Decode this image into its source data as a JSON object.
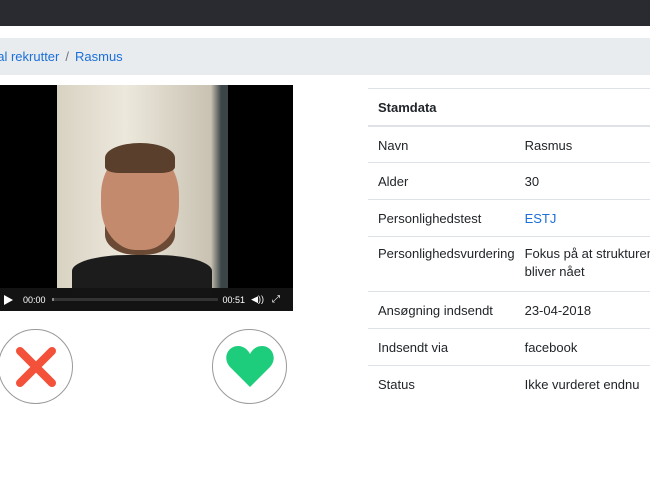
{
  "breadcrumb": {
    "items": [
      "nal rekrutter",
      "Rasmus"
    ],
    "separator": "/"
  },
  "video": {
    "current_time": "00:00",
    "duration": "00:51",
    "progress": 0
  },
  "actions": {
    "reject_icon": "x-icon",
    "reject_color": "#f4513a",
    "like_icon": "heart-icon",
    "like_color": "#1ecd7c"
  },
  "stamdata": {
    "title": "Stamdata",
    "rows": [
      {
        "label": "Navn",
        "value": "Rasmus"
      },
      {
        "label": "Alder",
        "value": "30"
      },
      {
        "label": "Personlighedstest",
        "value": "ESTJ"
      },
      {
        "label": "Personlighedsvurdering",
        "value": "Fokus på at strukturere",
        "value2": "bliver nået"
      },
      {
        "label": "Ansøgning indsendt",
        "value": "23-04-2018"
      },
      {
        "label": "Indsendt via",
        "value": "facebook"
      },
      {
        "label": "Status",
        "value": "Ikke vurderet endnu"
      }
    ]
  }
}
